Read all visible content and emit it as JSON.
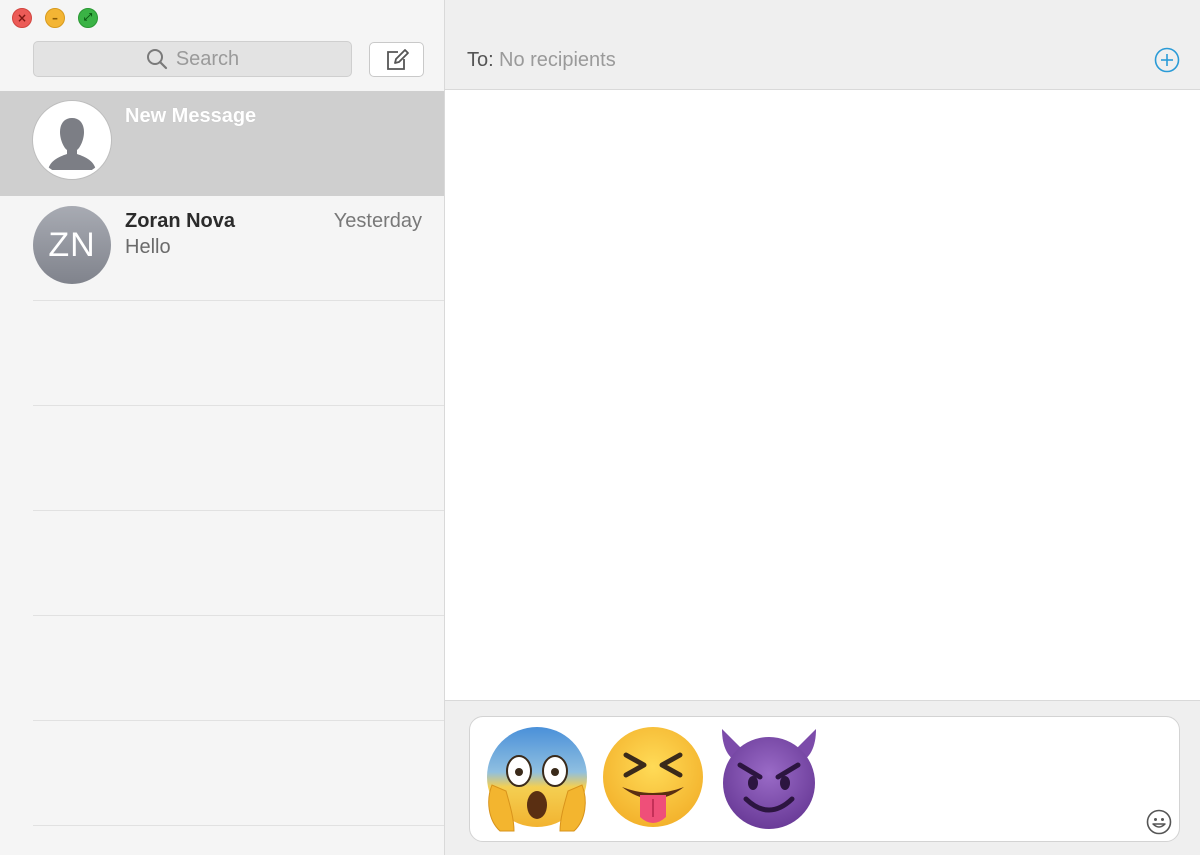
{
  "window": {
    "controls": {
      "close_icon": "close-icon",
      "minimize_icon": "minimize-icon",
      "fullscreen_icon": "fullscreen-icon"
    },
    "colors": {
      "close": "#ec5b57",
      "minimize": "#f3b534",
      "fullscreen": "#3ab345"
    }
  },
  "sidebar": {
    "search": {
      "placeholder": "Search",
      "icon": "search-icon"
    },
    "compose_icon": "compose-icon",
    "conversations": [
      {
        "title": "New Message",
        "avatar": "person-silhouette-icon",
        "selected": true
      },
      {
        "name": "Zoran Nova",
        "initials": "ZN",
        "time": "Yesterday",
        "preview": "Hello"
      }
    ]
  },
  "main": {
    "to_label": "To:",
    "recipients_placeholder": "No recipients",
    "add_icon": "add-circle-icon",
    "accent": "#2a9bd7"
  },
  "composer": {
    "emojis": [
      "face-screaming-in-fear",
      "squinting-face-with-tongue",
      "smiling-face-with-horns"
    ],
    "emoji_button_icon": "smiley-icon"
  }
}
